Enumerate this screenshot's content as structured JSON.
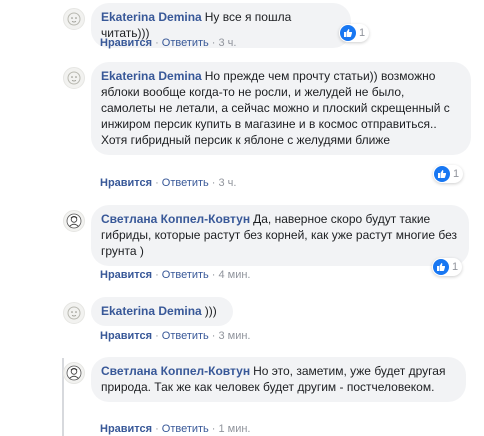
{
  "comments": [
    {
      "author": "Ekaterina Demina",
      "text": "Ну все я пошла читать)))",
      "actions": {
        "like": "Нравится",
        "reply": "Ответить",
        "time": "3 ч."
      },
      "reactions": "1",
      "avatar_icon": "generic-avatar-icon"
    },
    {
      "author": "Ekaterina Demina",
      "text": "Но прежде чем прочту статьи)) возможно яблоки вообще когда-то не росли, и желудей не было, самолеты не летали, а сейчас можно и плоский скрещенный с инжиром персик купить в магазине и в космос отправиться.. Хотя гибридный персик к яблоне с желудями ближе",
      "actions": {
        "like": "Нравится",
        "reply": "Ответить",
        "time": "3 ч."
      },
      "reactions": "1",
      "avatar_icon": "generic-avatar-icon"
    },
    {
      "author": "Светлана Коппел-Ковтун",
      "text": "Да, наверное скоро будут такие гибриды, которые растут без корней, как уже растут многие без грунта )",
      "actions": {
        "like": "Нравится",
        "reply": "Ответить",
        "time": "4 мин."
      },
      "reactions": "1",
      "avatar_icon": "portrait-avatar-icon"
    },
    {
      "author": "Ekaterina Demina",
      "text": ")))",
      "actions": {
        "like": "Нравится",
        "reply": "Ответить",
        "time": "3 мин."
      },
      "avatar_icon": "generic-avatar-icon"
    },
    {
      "author": "Светлана Коппел-Ковтун",
      "text": "Но это, заметим, уже будет другая природа. Так же как человек будет другим - постчеловеком.",
      "actions": {
        "like": "Нравится",
        "reply": "Ответить",
        "time": "1 мин."
      },
      "avatar_icon": "portrait-avatar-icon"
    }
  ],
  "separator": "·",
  "colors": {
    "link": "#385898",
    "bubble": "#f2f3f5",
    "meta": "#90949c",
    "like_blue": "#1877f2"
  }
}
